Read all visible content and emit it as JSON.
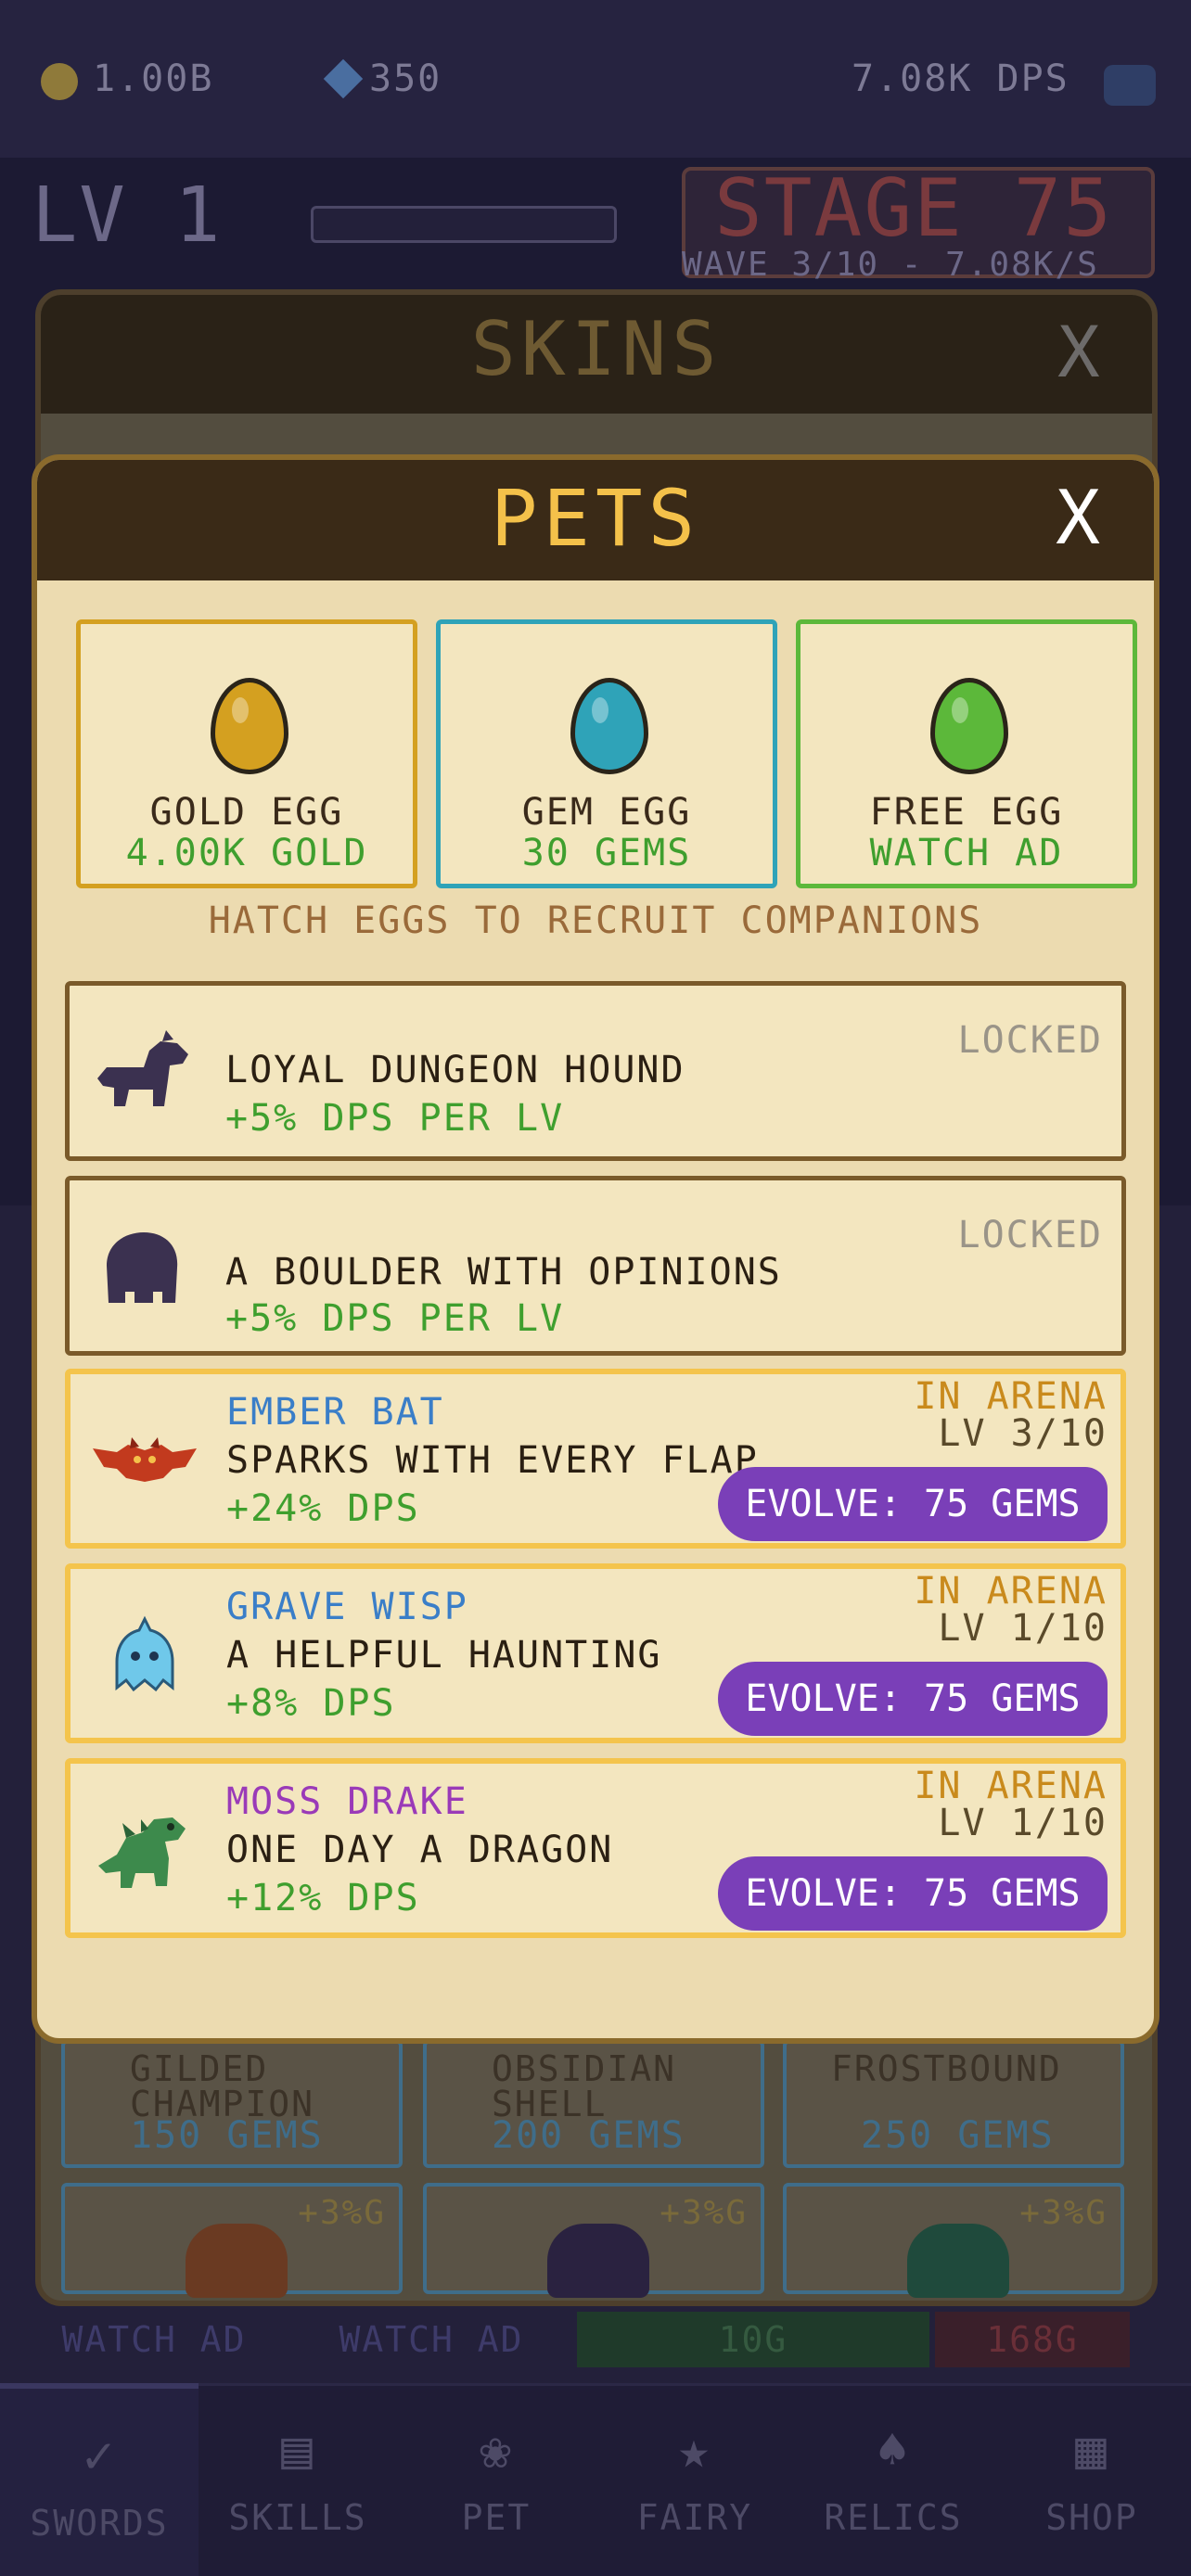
{
  "topbar": {
    "gold": "1.00B",
    "gems": "350",
    "dps": "7.08K DPS"
  },
  "level": {
    "label": "LV 1"
  },
  "stage": {
    "title": "STAGE 75",
    "wave": "WAVE 3/10 - 7.08K/S"
  },
  "skins": {
    "title": "SKINS",
    "close": "X",
    "cards": [
      {
        "name": "GILDED\nCHAMPION",
        "price": "150 GEMS"
      },
      {
        "name": "OBSIDIAN\nSHELL",
        "price": "200 GEMS"
      },
      {
        "name": "FROSTBOUND",
        "price": "250 GEMS"
      }
    ],
    "bonus": "+3%G",
    "bottom_buttons": [
      "WATCH AD",
      "WATCH AD",
      "10G",
      "168G"
    ]
  },
  "pets": {
    "title": "PETS",
    "close": "X",
    "eggs": [
      {
        "name": "GOLD EGG",
        "cost": "4.00K GOLD",
        "color": "#d4a020",
        "border": "#d4a020",
        "cost_color": "#3f9f2e"
      },
      {
        "name": "GEM EGG",
        "cost": "30 GEMS",
        "color": "#2fa3b8",
        "border": "#2fa3b8",
        "cost_color": "#3f9f2e"
      },
      {
        "name": "FREE EGG",
        "cost": "WATCH AD",
        "color": "#5cb83a",
        "border": "#5cb83a",
        "cost_color": "#3f9f2e"
      }
    ],
    "hint": "HATCH EGGS TO RECRUIT COMPANIONS",
    "locked": [
      {
        "desc": "LOYAL DUNGEON HOUND",
        "bonus": "+5% DPS PER LV",
        "status": "LOCKED",
        "icon": "hound-silhouette-icon"
      },
      {
        "desc": "A BOULDER WITH OPINIONS",
        "bonus": "+5% DPS PER LV",
        "status": "LOCKED",
        "icon": "boulder-silhouette-icon"
      }
    ],
    "owned": [
      {
        "name": "EMBER BAT",
        "name_color": "#3a7ec8",
        "desc": "SPARKS WITH EVERY FLAP",
        "bonus": "+24% DPS",
        "status": "IN ARENA",
        "level": "LV 3/10",
        "evolve": "EVOLVE: 75 GEMS",
        "icon": "ember-bat-icon"
      },
      {
        "name": "GRAVE WISP",
        "name_color": "#3a7ec8",
        "desc": "A HELPFUL HAUNTING",
        "bonus": "+8% DPS",
        "status": "IN ARENA",
        "level": "LV 1/10",
        "evolve": "EVOLVE: 75 GEMS",
        "icon": "grave-wisp-icon"
      },
      {
        "name": "MOSS DRAKE",
        "name_color": "#9a3ab8",
        "desc": "ONE DAY A DRAGON",
        "bonus": "+12% DPS",
        "status": "IN ARENA",
        "level": "LV 1/10",
        "evolve": "EVOLVE: 75 GEMS",
        "icon": "moss-drake-icon"
      }
    ]
  },
  "nav": [
    {
      "label": "SWORDS",
      "icon": "sword-icon"
    },
    {
      "label": "SKILLS",
      "icon": "scroll-icon"
    },
    {
      "label": "PET",
      "icon": "paw-icon"
    },
    {
      "label": "FAIRY",
      "icon": "star-icon"
    },
    {
      "label": "RELICS",
      "icon": "relic-icon"
    },
    {
      "label": "SHOP",
      "icon": "shop-icon"
    }
  ]
}
